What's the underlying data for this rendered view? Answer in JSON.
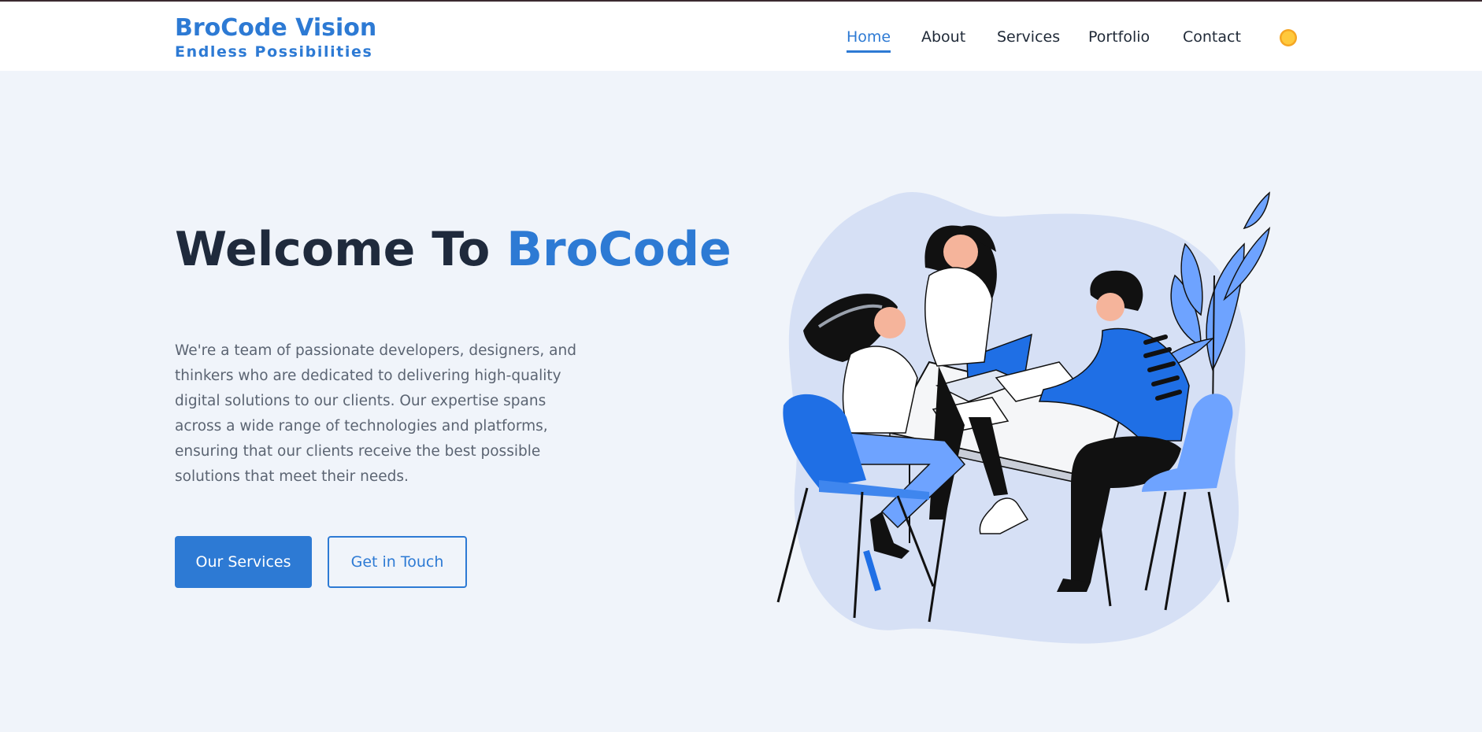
{
  "brand": {
    "title": "BroCode Vision",
    "subtitle": "Endless Possibilities"
  },
  "nav": {
    "items": [
      {
        "label": "Home",
        "active": true
      },
      {
        "label": "About",
        "active": false
      },
      {
        "label": "Services",
        "active": false
      },
      {
        "label": "Portfolio",
        "active": false
      },
      {
        "label": "Contact",
        "active": false
      }
    ],
    "theme_toggle_icon": "sun-icon"
  },
  "hero": {
    "title_prefix": "Welcome To ",
    "title_accent": "BroCode",
    "description": "We're a team of passionate developers, designers, and thinkers who are dedicated to delivering high-quality digital solutions to our clients. Our expertise spans across a wide range of technologies and platforms, ensuring that our clients receive the best possible solutions that meet their needs.",
    "primary_button": "Our Services",
    "secondary_button": "Get in Touch"
  },
  "colors": {
    "accent": "#2d7ad4",
    "background": "#f0f4fa",
    "heading": "#1f2a3c",
    "body_text": "#5b6472"
  }
}
